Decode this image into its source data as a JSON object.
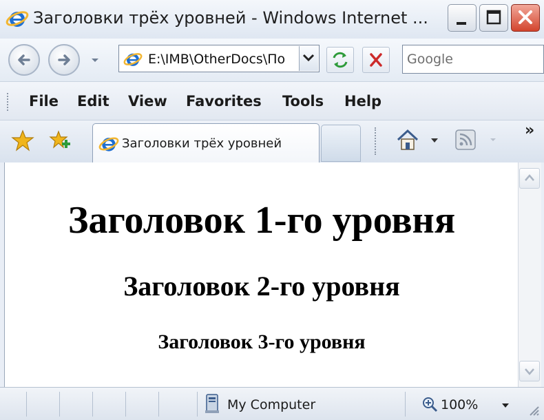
{
  "window": {
    "title": "Заголовки трёх уровней - Windows Internet ..."
  },
  "address_bar": {
    "url": "E:\\IMB\\OtherDocs\\По"
  },
  "search": {
    "placeholder": "Google"
  },
  "menu": {
    "items": [
      "File",
      "Edit",
      "View",
      "Favorites",
      "Tools",
      "Help"
    ]
  },
  "tabs": {
    "active_label": "Заголовки трёх уровней",
    "overflow_label": "»"
  },
  "content": {
    "h1": "Заголовок 1-го уровня",
    "h2": "Заголовок 2-го уровня",
    "h3": "Заголовок 3-го уровня"
  },
  "status": {
    "zone": "My Computer",
    "zoom": "100%"
  },
  "colors": {
    "ie_blue": "#1f6fd1",
    "ie_ring": "#f2b632",
    "close_red": "#d3442d",
    "refresh_green": "#2e9b3a",
    "stop_red": "#cc2a2a",
    "star_gold": "#f0b51c"
  }
}
